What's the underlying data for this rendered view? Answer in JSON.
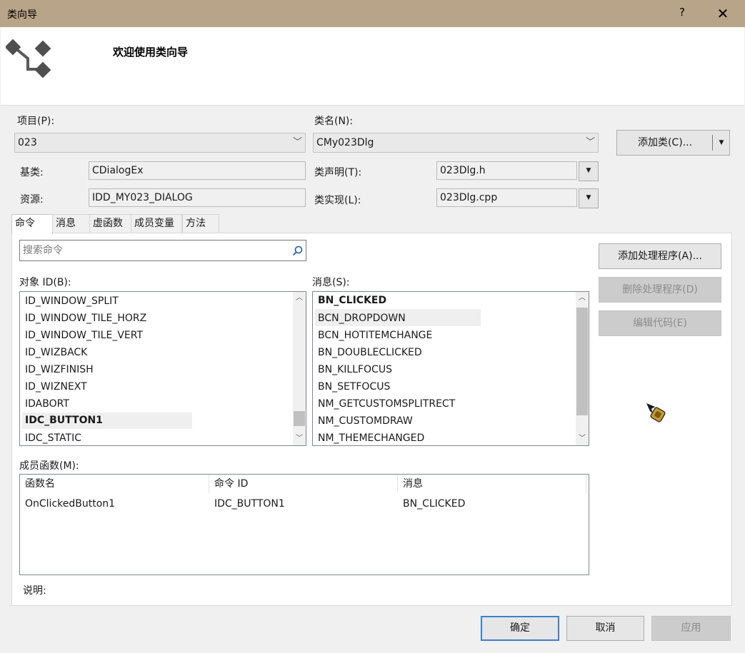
{
  "window": {
    "title": "类向导",
    "help_label": "?",
    "close_label": "✕"
  },
  "header": {
    "title": "欢迎使用类向导"
  },
  "project": {
    "label": "项目(P):",
    "value": "023"
  },
  "classname": {
    "label": "类名(N):",
    "value": "CMy023Dlg"
  },
  "add_class_button": {
    "label": "添加类(C)..."
  },
  "base_class": {
    "label": "基类:",
    "value": "CDialogEx"
  },
  "resource": {
    "label": "资源:",
    "value": "IDD_MY023_DIALOG"
  },
  "class_decl": {
    "label": "类声明(T):",
    "value": "023Dlg.h"
  },
  "class_impl": {
    "label": "类实现(L):",
    "value": "023Dlg.cpp"
  },
  "tabs": [
    {
      "label": "命令",
      "active": true
    },
    {
      "label": "消息",
      "active": false
    },
    {
      "label": "虚函数",
      "active": false
    },
    {
      "label": "成员变量",
      "active": false
    },
    {
      "label": "方法",
      "active": false
    }
  ],
  "search": {
    "placeholder": "搜索命令"
  },
  "object_ids": {
    "label": "对象 ID(B):",
    "items": [
      "ID_WINDOW_SPLIT",
      "ID_WINDOW_TILE_HORZ",
      "ID_WINDOW_TILE_VERT",
      "ID_WIZBACK",
      "ID_WIZFINISH",
      "ID_WIZNEXT",
      "IDABORT",
      "IDC_BUTTON1",
      "IDC_STATIC"
    ],
    "selected": "IDC_BUTTON1"
  },
  "messages": {
    "label": "消息(S):",
    "items": [
      "BN_CLICKED",
      "BCN_DROPDOWN",
      "BCN_HOTITEMCHANGE",
      "BN_DOUBLECLICKED",
      "BN_KILLFOCUS",
      "BN_SETFOCUS",
      "NM_GETCUSTOMSPLITRECT",
      "NM_CUSTOMDRAW",
      "NM_THEMECHANGED"
    ],
    "bold": "BN_CLICKED",
    "highlighted": "BCN_DROPDOWN"
  },
  "actions": {
    "add_handler": "添加处理程序(A)...",
    "delete_handler": "删除处理程序(D)",
    "edit_code": "编辑代码(E)"
  },
  "member_functions": {
    "label": "成员函数(M):",
    "columns": [
      "函数名",
      "命令 ID",
      "消息"
    ],
    "rows": [
      [
        "OnClickedButton1",
        "IDC_BUTTON1",
        "BN_CLICKED"
      ]
    ]
  },
  "description": {
    "label": "说明:"
  },
  "footer": {
    "ok": "确定",
    "cancel": "取消",
    "apply": "应用"
  },
  "colors": {
    "titlebar": "#b8a488",
    "focus_border": "#3c7fc9"
  },
  "icons": {
    "wizard": "class-wizard-icon",
    "search": "search-icon",
    "dropdown": "chevron-down-icon",
    "cursor": "busy-cursor-icon"
  }
}
